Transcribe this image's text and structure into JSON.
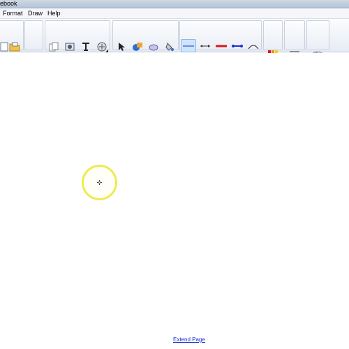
{
  "window": {
    "title": "ebook"
  },
  "menu": {
    "items": [
      "Format",
      "Draw",
      "Help"
    ]
  },
  "toolbar": {
    "pen_colors": {
      "red": "#e0141b",
      "blue": "#1c2fd0",
      "green": "#23b02c",
      "magenta": "#e01ad6",
      "selection": "#9dcbf5"
    }
  },
  "canvas": {
    "extend_link": "Extend Page"
  },
  "accent": {
    "cursor_highlight": "#eeea52",
    "link": "#1a2bd6"
  }
}
